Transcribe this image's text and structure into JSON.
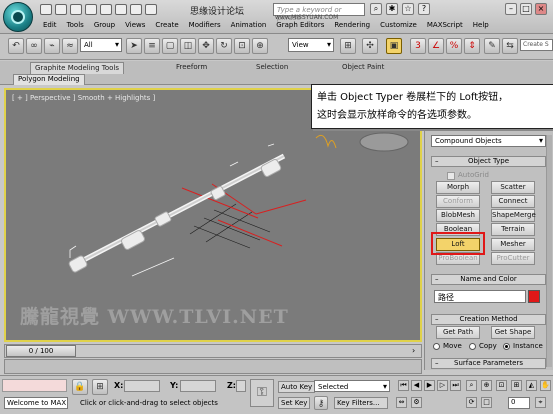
{
  "title_bar": {
    "title": "思缘设计论坛",
    "search_placeholder": "Type a keyword or phrase",
    "url_overlay": "www.MISSYUAN.COM"
  },
  "menu": [
    "Edit",
    "Tools",
    "Group",
    "Views",
    "Create",
    "Modifiers",
    "Animation",
    "Graph Editors",
    "Rendering",
    "Customize",
    "MAXScript",
    "Help"
  ],
  "toolbar": {
    "selection_filter": "All",
    "reference_coord": "View",
    "create_selection_set": "Create S"
  },
  "ribbon": {
    "tabs": [
      "Graphite Modeling Tools",
      "Freeform",
      "Selection",
      "Object Paint"
    ],
    "subtab": "Polygon Modeling"
  },
  "viewport": {
    "label": "[ + ] Perspective ] Smooth + Highlights ]",
    "watermark": "騰龍視覺 WWW.TLVI.NET"
  },
  "callout": {
    "line1": "单击 Object Typer 卷展栏下的 Loft按钮，",
    "line2": "这时会显示放样命令的各选项参数。"
  },
  "command_panel": {
    "category": "Compound Objects",
    "object_type_title": "Object Type",
    "autogrid_label": "AutoGrid",
    "buttons": [
      {
        "label": "Morph",
        "state": "normal"
      },
      {
        "label": "Scatter",
        "state": "normal"
      },
      {
        "label": "Conform",
        "state": "disabled"
      },
      {
        "label": "Connect",
        "state": "normal"
      },
      {
        "label": "BlobMesh",
        "state": "normal"
      },
      {
        "label": "ShapeMerge",
        "state": "normal"
      },
      {
        "label": "Boolean",
        "state": "normal"
      },
      {
        "label": "Terrain",
        "state": "normal"
      },
      {
        "label": "Loft",
        "state": "selected"
      },
      {
        "label": "Mesher",
        "state": "normal"
      },
      {
        "label": "ProBoolean",
        "state": "disabled"
      },
      {
        "label": "ProCutter",
        "state": "disabled"
      }
    ],
    "name_color_title": "Name and Color",
    "name_value": "路径",
    "object_color": "#e01818",
    "creation_method_title": "Creation Method",
    "get_path": "Get Path",
    "get_shape": "Get Shape",
    "radio_move": "Move",
    "radio_copy": "Copy",
    "radio_instance": "Instance",
    "surface_params_title": "Surface Parameters"
  },
  "time_slider": {
    "frame_display": "0 / 100"
  },
  "status_bar": {
    "welcome": "Welcome to MAX!",
    "prompt": "Click or click-and-drag to select objects",
    "x_label": "X:",
    "y_label": "Y:",
    "z_label": "Z:",
    "auto_key": "Auto Key",
    "set_key": "Set Key",
    "selected": "Selected",
    "key_filters": "Key Filters...",
    "current_frame": "0"
  }
}
